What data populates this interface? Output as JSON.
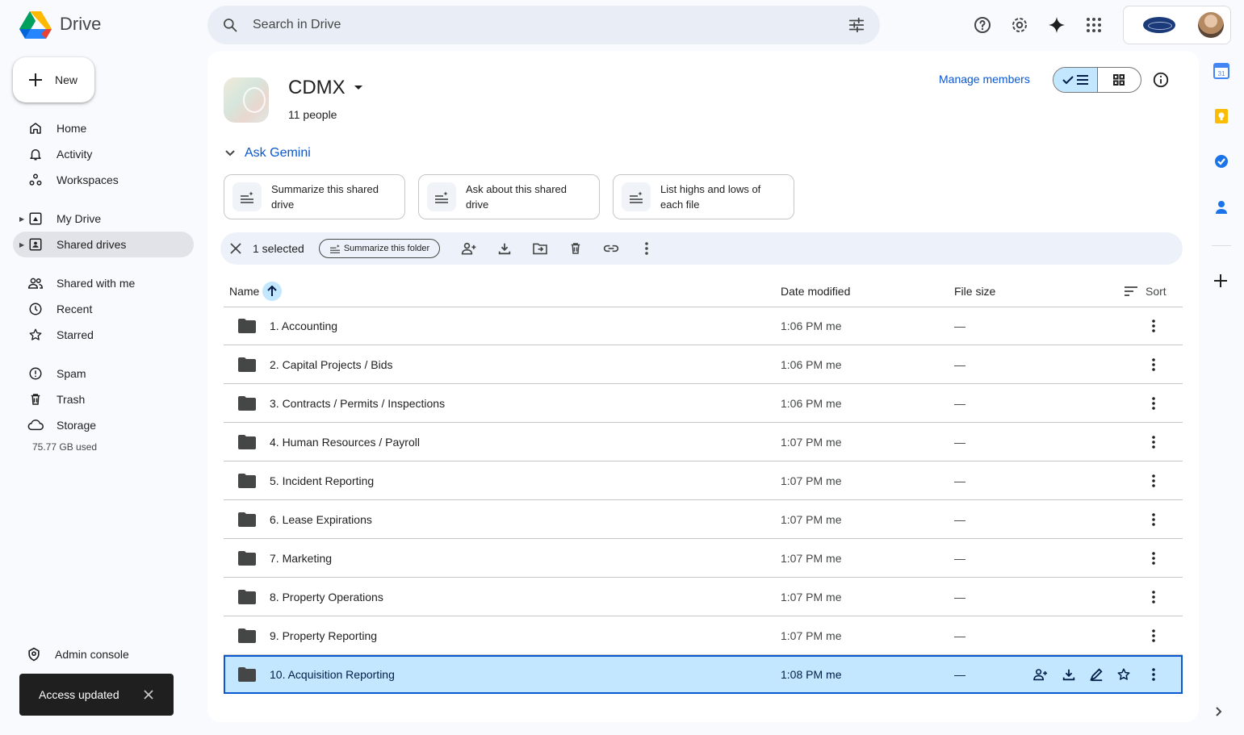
{
  "app": {
    "name": "Drive"
  },
  "search": {
    "placeholder": "Search in Drive"
  },
  "sidebar": {
    "new_label": "New",
    "items": [
      {
        "label": "Home",
        "icon": "home-icon"
      },
      {
        "label": "Activity",
        "icon": "bell-icon"
      },
      {
        "label": "Workspaces",
        "icon": "workspaces-icon"
      },
      {
        "label": "My Drive",
        "icon": "my-drive-icon"
      },
      {
        "label": "Shared drives",
        "icon": "shared-drives-icon",
        "active": true
      },
      {
        "label": "Shared with me",
        "icon": "people-icon"
      },
      {
        "label": "Recent",
        "icon": "clock-icon"
      },
      {
        "label": "Starred",
        "icon": "star-icon"
      },
      {
        "label": "Spam",
        "icon": "spam-icon"
      },
      {
        "label": "Trash",
        "icon": "trash-icon"
      },
      {
        "label": "Storage",
        "icon": "cloud-icon"
      }
    ],
    "storage_used": "75.77 GB used",
    "admin_label": "Admin console"
  },
  "toast": {
    "message": "Access updated"
  },
  "drive": {
    "title": "CDMX",
    "members": "11 people",
    "manage_members": "Manage members"
  },
  "gemini": {
    "label": "Ask Gemini",
    "chips": [
      {
        "line1": "Summarize this shared",
        "line2": "drive"
      },
      {
        "line1": "Ask about this shared",
        "line2": "drive"
      },
      {
        "line1": "List highs and lows of",
        "line2": "each file"
      }
    ]
  },
  "selection": {
    "count_label": "1 selected",
    "summarize_folder": "Summarize this folder"
  },
  "table": {
    "columns": {
      "name": "Name",
      "date": "Date modified",
      "size": "File size",
      "sort": "Sort"
    },
    "rows": [
      {
        "name": "1. Accounting",
        "date": "1:06 PM me",
        "size": "—"
      },
      {
        "name": "2. Capital Projects / Bids",
        "date": "1:06 PM me",
        "size": "—"
      },
      {
        "name": "3. Contracts / Permits / Inspections",
        "date": "1:06 PM me",
        "size": "—"
      },
      {
        "name": "4. Human Resources / Payroll",
        "date": "1:07 PM me",
        "size": "—"
      },
      {
        "name": "5. Incident Reporting",
        "date": "1:07 PM me",
        "size": "—"
      },
      {
        "name": "6. Lease Expirations",
        "date": "1:07 PM me",
        "size": "—"
      },
      {
        "name": "7. Marketing",
        "date": "1:07 PM me",
        "size": "—"
      },
      {
        "name": "8. Property Operations",
        "date": "1:07 PM me",
        "size": "—"
      },
      {
        "name": "9. Property Reporting",
        "date": "1:07 PM me",
        "size": "—"
      },
      {
        "name": "10. Acquisition Reporting",
        "date": "1:08 PM me",
        "size": "—",
        "selected": true
      }
    ]
  },
  "colors": {
    "accent": "#0b57d0",
    "selected_bg": "#c2e7ff",
    "app_bg": "#f8fafd"
  }
}
